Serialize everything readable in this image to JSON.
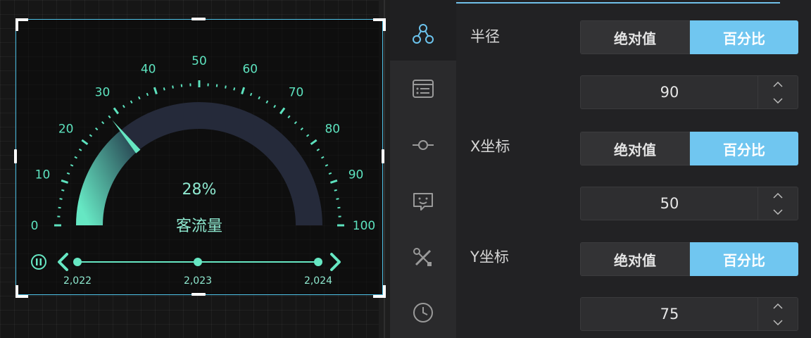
{
  "gauge": {
    "percent_text": "28%",
    "title": "客流量",
    "value_fraction": 0.28,
    "ticks": [
      "0",
      "10",
      "20",
      "30",
      "40",
      "50",
      "60",
      "70",
      "80",
      "90",
      "100"
    ],
    "accent": "#5de3bf",
    "track_color": "#252a3a"
  },
  "timeline": {
    "years": [
      "2,022",
      "2,023",
      "2,024"
    ]
  },
  "panel": {
    "fields": [
      {
        "label": "半径",
        "opt_absolute": "绝对值",
        "opt_percent": "百分比",
        "value": "90"
      },
      {
        "label": "X坐标",
        "opt_absolute": "绝对值",
        "opt_percent": "百分比",
        "value": "50"
      },
      {
        "label": "Y坐标",
        "opt_absolute": "绝对值",
        "opt_percent": "百分比",
        "value": "75"
      }
    ],
    "rail_icons": [
      "share-nodes-icon",
      "list-icon",
      "commit-icon",
      "chat-smile-icon",
      "tools-icon",
      "clock-icon"
    ],
    "selected_color": "#70c6f0"
  }
}
